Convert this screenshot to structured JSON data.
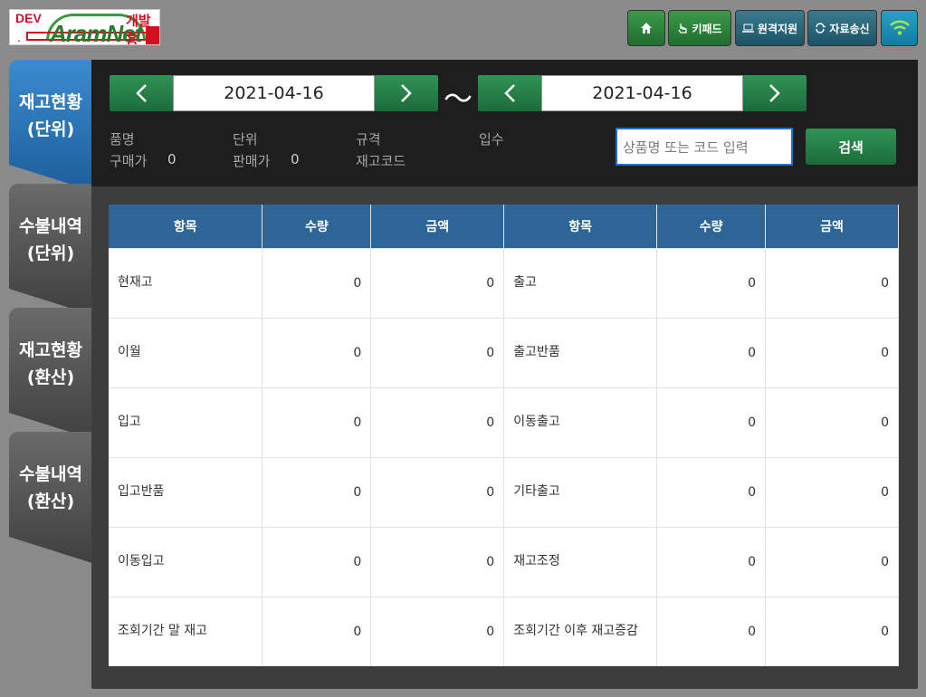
{
  "logo": {
    "dev": "DEV",
    "dot": ".",
    "brand": "AramNet",
    "korean": "개발용"
  },
  "topbar": {
    "home_label": "",
    "keypad_label": "키패드",
    "remote_label": "원격지원",
    "send_label": "자료송신"
  },
  "tabs": [
    {
      "line1": "재고현황",
      "line2": "(단위)"
    },
    {
      "line1": "수불내역",
      "line2": "(단위)"
    },
    {
      "line1": "재고현황",
      "line2": "(환산)"
    },
    {
      "line1": "수불내역",
      "line2": "(환산)"
    }
  ],
  "date": {
    "start": "2021-04-16",
    "end": "2021-04-16",
    "tilde": "〜"
  },
  "info": {
    "product_name": "품명",
    "unit": "단위",
    "spec": "규격",
    "qty_per_pack": "입수",
    "purchase_price": "구매가",
    "purchase_price_value": "0",
    "sale_price": "판매가",
    "sale_price_value": "0",
    "stock_code": "재고코드"
  },
  "search": {
    "placeholder": "상품명 또는 코드 입력",
    "button": "검색"
  },
  "table": {
    "headers": [
      "항목",
      "수량",
      "금액",
      "항목",
      "수량",
      "금액"
    ],
    "rows": [
      {
        "left": "현재고",
        "lq": "0",
        "la": "0",
        "right": "출고",
        "rq": "0",
        "ra": "0"
      },
      {
        "left": "이월",
        "lq": "0",
        "la": "0",
        "right": "출고반품",
        "rq": "0",
        "ra": "0"
      },
      {
        "left": "입고",
        "lq": "0",
        "la": "0",
        "right": "이동출고",
        "rq": "0",
        "ra": "0"
      },
      {
        "left": "입고반품",
        "lq": "0",
        "la": "0",
        "right": "기타출고",
        "rq": "0",
        "ra": "0"
      },
      {
        "left": "이동입고",
        "lq": "0",
        "la": "0",
        "right": "재고조정",
        "rq": "0",
        "ra": "0"
      },
      {
        "left": "조회기간 말 재고",
        "lq": "0",
        "la": "0",
        "right": "조회기간 이후 재고증감",
        "rq": "0",
        "ra": "0"
      }
    ]
  }
}
